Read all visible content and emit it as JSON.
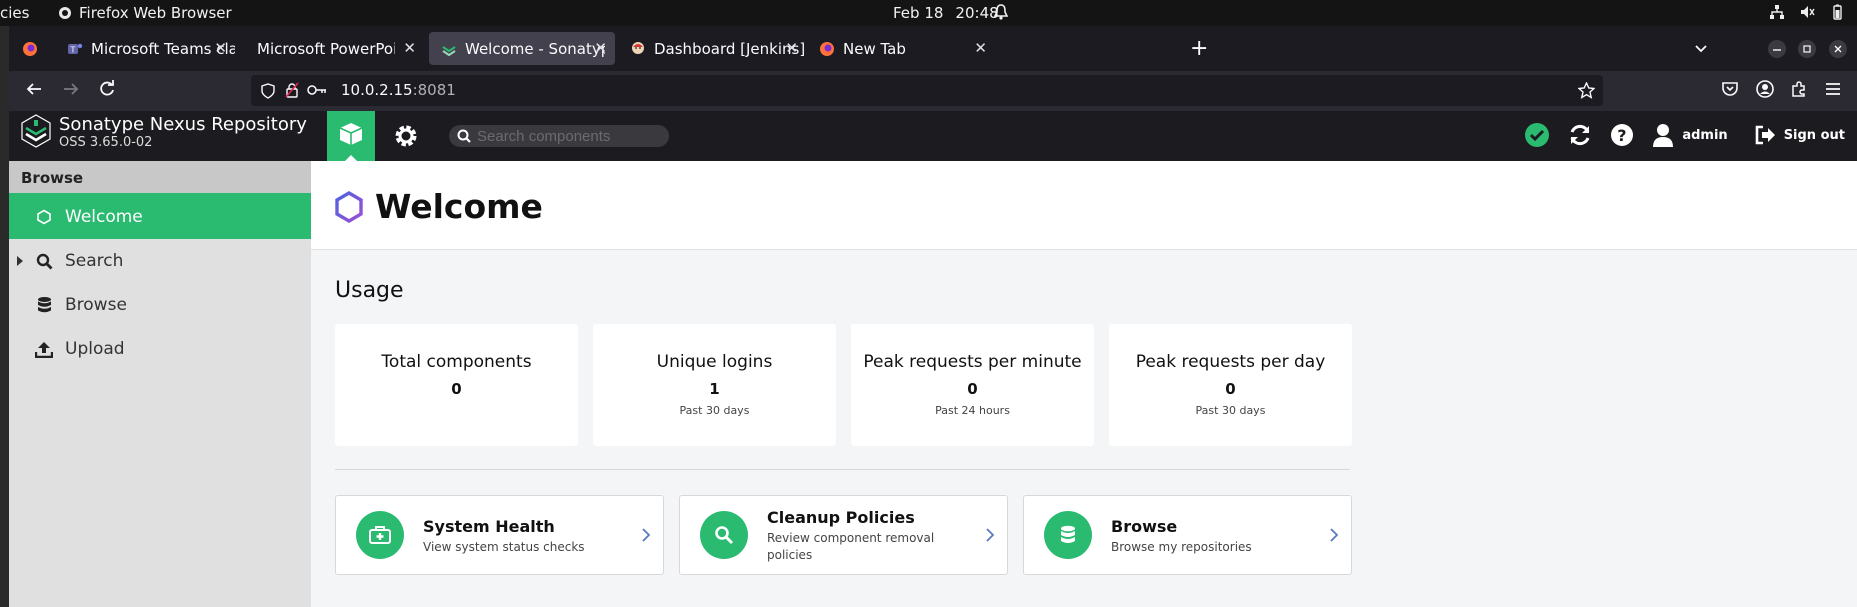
{
  "os_bar": {
    "left_truncated": "cies",
    "app_name": "Firefox Web Browser",
    "date": "Feb 18",
    "time": "20:48"
  },
  "browser": {
    "tabs": [
      {
        "title": "Microsoft Teams classic",
        "icon": "teams-icon"
      },
      {
        "title": "Microsoft PowerPoint - cour",
        "icon": "blank"
      },
      {
        "title": "Welcome - Sonatype Nex",
        "icon": "nexus-icon",
        "active": true
      },
      {
        "title": "Dashboard [Jenkins]",
        "icon": "jenkins-icon"
      },
      {
        "title": "New Tab",
        "icon": "firefox-icon"
      }
    ],
    "url_host": "10.0.2.15",
    "url_port": ":8081"
  },
  "nexus": {
    "product_name": "Sonatype Nexus Repository",
    "version": "OSS 3.65.0-02",
    "search_placeholder": "Search components",
    "user": "admin",
    "signout_label": "Sign out"
  },
  "sidebar": {
    "title": "Browse",
    "items": [
      {
        "label": "Welcome",
        "icon": "hexagon-icon",
        "active": true
      },
      {
        "label": "Search",
        "icon": "search-icon"
      },
      {
        "label": "Browse",
        "icon": "database-icon"
      },
      {
        "label": "Upload",
        "icon": "upload-icon"
      }
    ]
  },
  "main": {
    "page_title": "Welcome",
    "usage_title": "Usage",
    "stats": [
      {
        "label": "Total components",
        "value": "0",
        "sub": ""
      },
      {
        "label": "Unique logins",
        "value": "1",
        "sub": "Past 30 days"
      },
      {
        "label": "Peak requests per minute",
        "value": "0",
        "sub": "Past 24 hours"
      },
      {
        "label": "Peak requests per day",
        "value": "0",
        "sub": "Past 30 days"
      }
    ],
    "actions": [
      {
        "title": "System Health",
        "desc": "View system status checks",
        "icon": "first-aid-kit-icon"
      },
      {
        "title": "Cleanup Policies",
        "desc": "Review component removal policies",
        "icon": "search-icon"
      },
      {
        "title": "Browse",
        "desc": "Browse my repositories",
        "icon": "database-icon"
      }
    ]
  },
  "colors": {
    "accent": "#2aba70",
    "header_bg": "#1c1b1f",
    "sidebar_bg": "#e0e0e0"
  }
}
